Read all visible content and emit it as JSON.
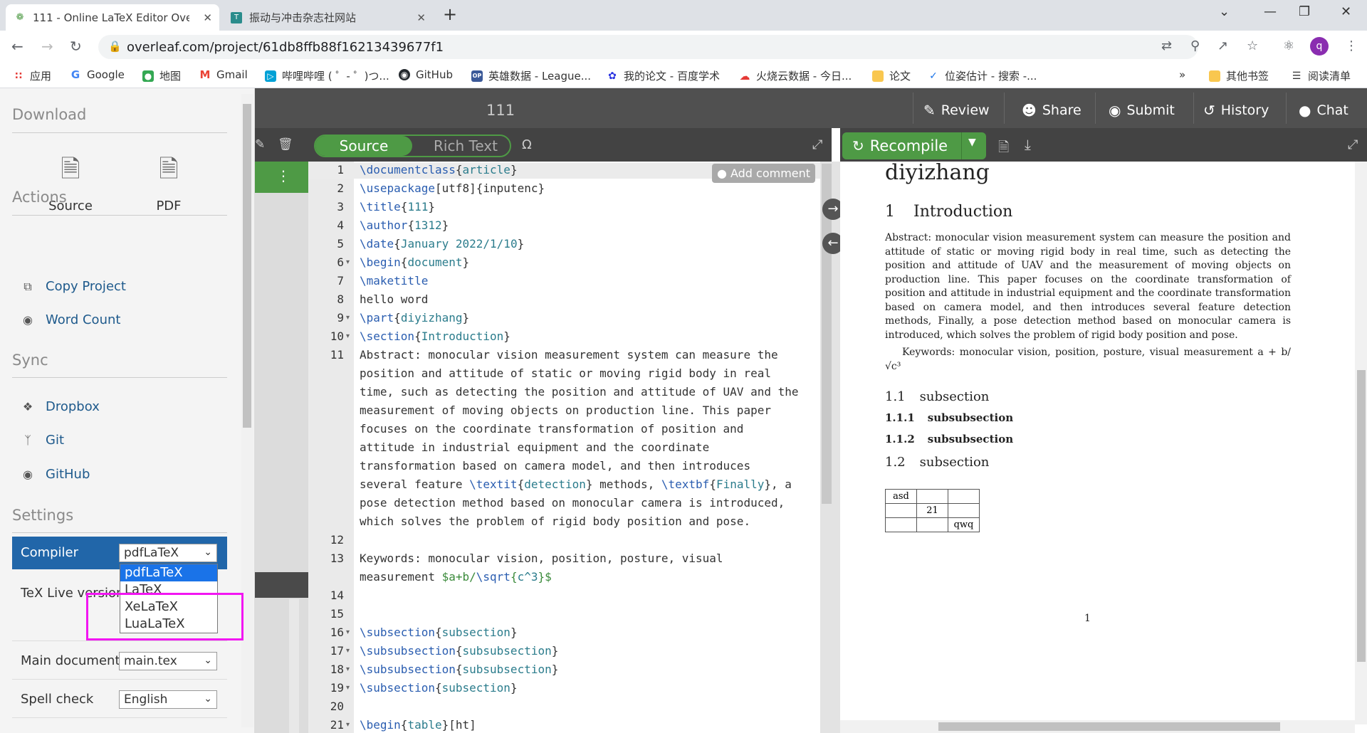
{
  "browser": {
    "tabs": [
      {
        "title": "111 - Online LaTeX Editor Ove",
        "active": true
      },
      {
        "title": "振动与冲击杂志社网站",
        "active": false
      }
    ],
    "new_tab": "+",
    "url": "overleaf.com/project/61db8ffb88f16213439677f1",
    "profile_initial": "q",
    "bookmarks": [
      {
        "label": "应用",
        "color": "#4285f4"
      },
      {
        "label": "Google",
        "color": "#4285f4"
      },
      {
        "label": "地图",
        "color": "#34a853"
      },
      {
        "label": "Gmail",
        "color": "#ea4335"
      },
      {
        "label": "哔哩哔哩 ( ゜- ゜)つ...",
        "color": "#00a1d6"
      },
      {
        "label": "GitHub",
        "color": "#24292e"
      },
      {
        "label": "英雄数据 - League...",
        "color": "#3b5998"
      },
      {
        "label": "我的论文 - 百度学术",
        "color": "#2932e1"
      },
      {
        "label": "火烧云数据 - 今日...",
        "color": "#e53935"
      },
      {
        "label": "论文",
        "color": "#f9c74f"
      },
      {
        "label": "位姿估计 - 搜索 -...",
        "color": "#1a73e8"
      }
    ],
    "bookmarks_more": "»",
    "other_bookmarks": "其他书签",
    "reading_list": "阅读清单"
  },
  "left": {
    "download_heading": "Download",
    "download_source": "Source",
    "download_pdf": "PDF",
    "actions_heading": "Actions",
    "copy_project": "Copy Project",
    "word_count": "Word Count",
    "sync_heading": "Sync",
    "dropbox": "Dropbox",
    "git": "Git",
    "github": "GitHub",
    "settings_heading": "Settings",
    "compiler_label": "Compiler",
    "compiler_value": "pdfLaTeX",
    "compiler_options": [
      "pdfLaTeX",
      "LaTeX",
      "XeLaTeX",
      "LuaLaTeX"
    ],
    "texlive_label": "TeX Live version",
    "main_doc_label": "Main document",
    "main_doc_value": "main.tex",
    "spell_label": "Spell check",
    "spell_value": "English"
  },
  "topbar": {
    "project_title": "111",
    "review": "Review",
    "share": "Share",
    "submit": "Submit",
    "history": "History",
    "chat": "Chat"
  },
  "editor": {
    "source_label": "Source",
    "rich_text_label": "Rich Text",
    "omega": "Ω",
    "add_comment": "Add comment",
    "recompile": "Recompile"
  },
  "code_lines": [
    {
      "n": "1",
      "t": "\\documentclass{article}"
    },
    {
      "n": "2",
      "t": "\\usepackage[utf8]{inputenc}"
    },
    {
      "n": "3",
      "t": "\\title{111}"
    },
    {
      "n": "4",
      "t": "\\author{1312}"
    },
    {
      "n": "5",
      "t": "\\date{January 2022/1/10}"
    },
    {
      "n": "6",
      "t": "\\begin{document}"
    },
    {
      "n": "7",
      "t": "\\maketitle"
    },
    {
      "n": "8",
      "t": "hello word"
    },
    {
      "n": "9",
      "t": "\\part{diyizhang}"
    },
    {
      "n": "10",
      "t": "\\section{Introduction}"
    },
    {
      "n": "11",
      "t": "Abstract: monocular vision measurement system can measure the"
    },
    {
      "n": "",
      "t": "position and attitude of static or moving rigid body in real"
    },
    {
      "n": "",
      "t": "time, such as detecting the position and attitude of UAV and the"
    },
    {
      "n": "",
      "t": "measurement of moving objects on production line. This paper"
    },
    {
      "n": "",
      "t": "focuses on the coordinate transformation of position and"
    },
    {
      "n": "",
      "t": "attitude in industrial equipment and the coordinate"
    },
    {
      "n": "",
      "t": "transformation based on camera model, and then introduces"
    },
    {
      "n": "",
      "t": "several feature \\textit{detection} methods, \\textbf{Finally}, a"
    },
    {
      "n": "",
      "t": "pose detection method based on monocular camera is introduced,"
    },
    {
      "n": "",
      "t": "which solves the problem of rigid body position and pose."
    },
    {
      "n": "12",
      "t": ""
    },
    {
      "n": "13",
      "t": "Keywords: monocular vision, position, posture, visual"
    },
    {
      "n": "",
      "t": "measurement $a+b/\\sqrt{c^3}$"
    },
    {
      "n": "14",
      "t": ""
    },
    {
      "n": "15",
      "t": ""
    },
    {
      "n": "16",
      "t": "\\subsection{subsection}"
    },
    {
      "n": "17",
      "t": "\\subsubsection{subsubsection}"
    },
    {
      "n": "18",
      "t": "\\subsubsection{subsubsection}"
    },
    {
      "n": "19",
      "t": "\\subsection{subsection}"
    },
    {
      "n": "20",
      "t": ""
    },
    {
      "n": "21",
      "t": "\\begin{table}[ht]"
    }
  ],
  "pdf": {
    "part_title": "diyizhang",
    "section_num": "1",
    "section_title": "Introduction",
    "abstract": "Abstract: monocular vision measurement system can measure the position and attitude of static or moving rigid body in real time, such as detecting the position and attitude of UAV and the measurement of moving objects on production line. This paper focuses on the coordinate transformation of position and attitude in industrial equipment and the coordinate transformation based on camera model, and then introduces several feature detection methods, Finally, a pose detection method based on monocular camera is introduced, which solves the problem of rigid body position and pose.",
    "keywords": "Keywords: monocular vision, position, posture, visual measurement a + b/√c³",
    "sub1_num": "1.1",
    "sub1": "subsection",
    "subsub1_num": "1.1.1",
    "subsub1": "subsubsection",
    "subsub2_num": "1.1.2",
    "subsub2": "subsubsection",
    "sub2_num": "1.2",
    "sub2": "subsection",
    "table": [
      [
        "asd",
        "",
        ""
      ],
      [
        "",
        "21",
        ""
      ],
      [
        "",
        "",
        "qwq"
      ]
    ],
    "page_number": "1"
  }
}
